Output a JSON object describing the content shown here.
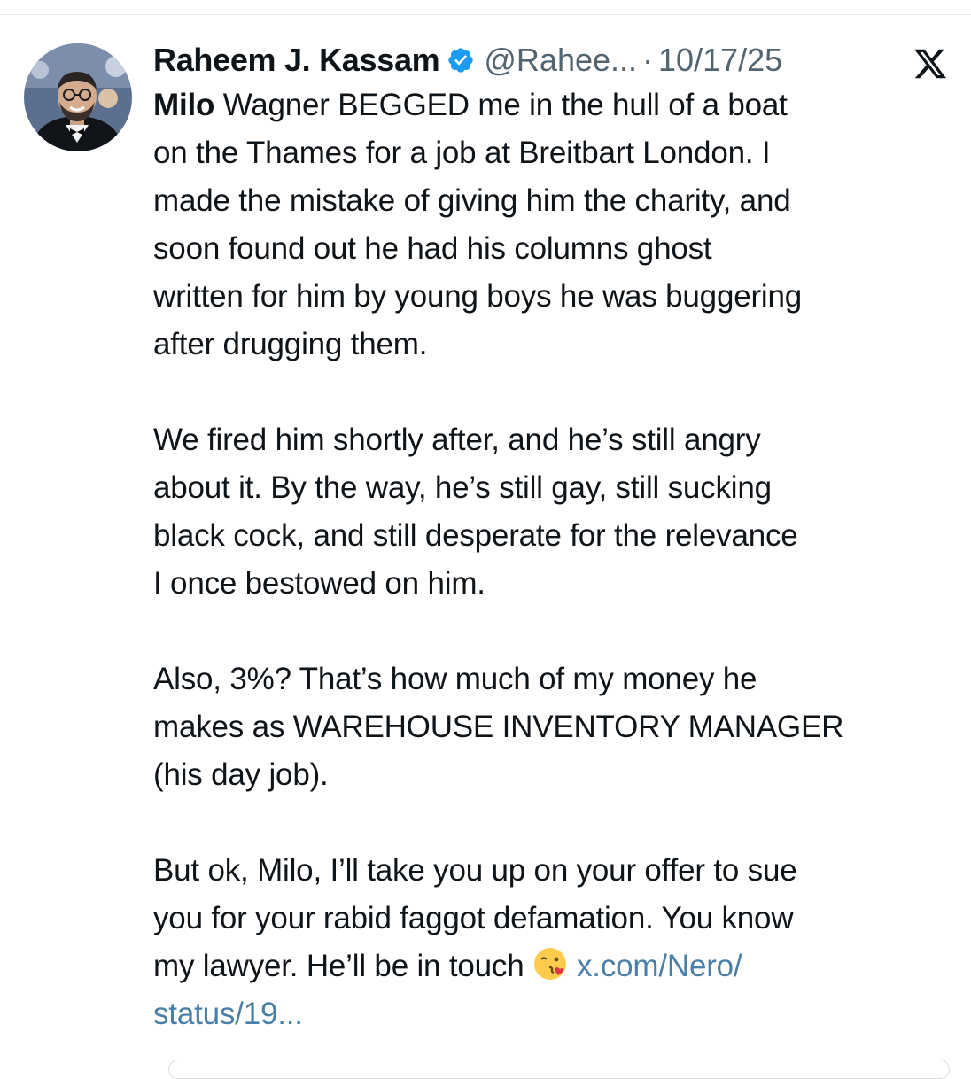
{
  "tweet": {
    "author": {
      "display_name": "Raheem J. Kassam",
      "handle": "@Rahee...",
      "separator": "·",
      "date": "10/17/25",
      "verified": true,
      "verified_color": "#1d9bf0",
      "avatar_icon": "profile-photo"
    },
    "platform_icon": "x-logo-icon",
    "paragraphs": [
      {
        "lines": [
          {
            "bold_prefix": "Milo",
            "text": " Wagner BEGGED me in the hull of a boat"
          },
          {
            "text": "on the Thames for a job at Breitbart London. I"
          },
          {
            "text": "made the mistake of giving him the charity, and"
          },
          {
            "text": "soon found out he had his columns ghost"
          },
          {
            "text": "written for him by young boys he was buggering"
          },
          {
            "text": "after drugging them."
          }
        ]
      },
      {
        "lines": [
          {
            "text": "We fired him shortly after, and he’s still angry"
          },
          {
            "text": "about it. By the way, he’s still gay, still sucking"
          },
          {
            "text": "black cock, and still desperate for the relevance"
          },
          {
            "text": "I once bestowed on him."
          }
        ]
      },
      {
        "lines": [
          {
            "text": "Also, 3%? That’s how much of my money he"
          },
          {
            "text": "makes as WAREHOUSE INVENTORY MANAGER"
          },
          {
            "text": "(his day job)."
          }
        ]
      },
      {
        "lines": [
          {
            "text": "But ok, Milo, I’ll take you up on your offer to sue"
          },
          {
            "text": "you for your rabid faggot defamation. You know"
          },
          {
            "text": "my lawyer. He’ll be in touch ",
            "emoji": "face-blowing-a-kiss-icon",
            "link": "x.com/Nero/"
          },
          {
            "link_only": "status/19..."
          }
        ]
      }
    ],
    "link_color": "#4a7fa8"
  }
}
